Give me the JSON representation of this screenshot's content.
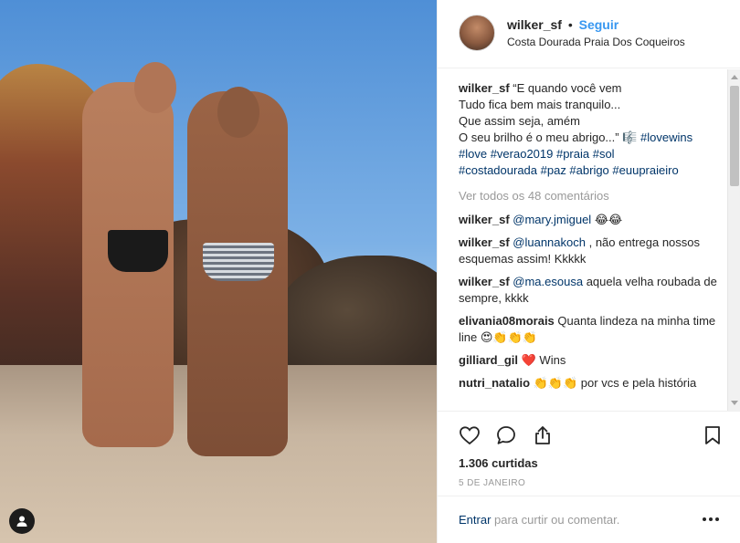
{
  "post": {
    "username": "wilker_sf",
    "dot": "•",
    "follow_label": "Seguir",
    "location": "Costa Dourada Praia Dos Coqueiros"
  },
  "caption": {
    "username": "wilker_sf",
    "lines": [
      "“E quando você vem",
      "Tudo fica bem mais tranquilo...",
      "Que assim seja, amém",
      "O seu brilho é o meu abrigo...” 🎼 "
    ],
    "hashtags_line4": "#lovewins",
    "hashtags_line5": "#love #verao2019 #praia #sol",
    "hashtags_line6": "#costadourada #paz #abrigo #euupraieiro"
  },
  "view_all_comments": "Ver todos os 48 comentários",
  "comments": [
    {
      "user": "wilker_sf",
      "mention": "@mary.jmiguel",
      "text": " 😂😂"
    },
    {
      "user": "wilker_sf",
      "mention": "@luannakoch",
      "text": " , não entrega nossos esquemas assim! Kkkkk"
    },
    {
      "user": "wilker_sf",
      "mention": "@ma.esousa",
      "text": " aquela velha roubada de sempre, kkkk"
    },
    {
      "user": "elivania08morais",
      "mention": "",
      "text": " Quanta lindeza na minha time line 😍👏👏👏"
    },
    {
      "user": "gilliard_gil",
      "mention": "",
      "text": " ❤️ Wins"
    },
    {
      "user": "nutri_natalio",
      "mention": "",
      "text": " 👏👏👏 por vcs e pela história"
    }
  ],
  "likes": "1.306 curtidas",
  "date": "5 DE JANEIRO",
  "add_comment": {
    "link": "Entrar",
    "text": " para curtir ou comentar."
  },
  "icons": {
    "like": "heart-outline-icon",
    "comment": "speech-bubble-icon",
    "share": "share-arrow-icon",
    "save": "bookmark-icon",
    "more": "more-dots-icon",
    "tag": "user-tag-icon"
  },
  "colors": {
    "follow": "#3897f0",
    "link": "#003569",
    "muted": "#999999",
    "text": "#262626"
  }
}
